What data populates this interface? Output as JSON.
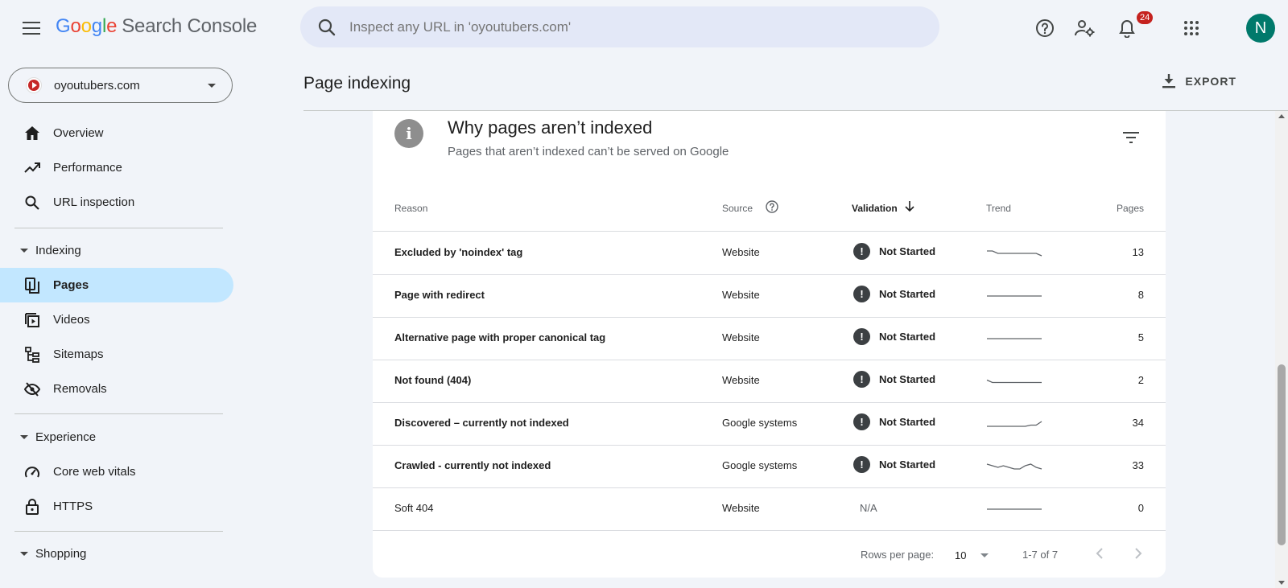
{
  "app": {
    "logo_letters": [
      "G",
      "o",
      "o",
      "g",
      "l",
      "e"
    ],
    "product": "Search Console"
  },
  "search": {
    "placeholder": "Inspect any URL in 'oyoutubers.com'"
  },
  "topbar": {
    "notification_count": "24",
    "avatar_initial": "N"
  },
  "property": {
    "name": "oyoutubers.com"
  },
  "nav": {
    "overview": "Overview",
    "performance": "Performance",
    "url_inspection": "URL inspection",
    "indexing_section": "Indexing",
    "pages": "Pages",
    "videos": "Videos",
    "sitemaps": "Sitemaps",
    "removals": "Removals",
    "experience_section": "Experience",
    "core_web_vitals": "Core web vitals",
    "https": "HTTPS",
    "shopping_section": "Shopping"
  },
  "header": {
    "title": "Page indexing",
    "export_label": "EXPORT"
  },
  "card": {
    "title": "Why pages aren’t indexed",
    "subtitle": "Pages that aren’t indexed can’t be served on Google",
    "columns": {
      "reason": "Reason",
      "source": "Source",
      "validation": "Validation",
      "trend": "Trend",
      "pages": "Pages"
    },
    "rows": [
      {
        "reason": "Excluded by 'noindex' tag",
        "source": "Website",
        "validation": "Not Started",
        "pages": "13",
        "trend": [
          13,
          13,
          12,
          12,
          12,
          12,
          12,
          12,
          12,
          12,
          11
        ]
      },
      {
        "reason": "Page with redirect",
        "source": "Website",
        "validation": "Not Started",
        "pages": "8",
        "trend": [
          8,
          8,
          8,
          8,
          8,
          8,
          8,
          8,
          8,
          8,
          8
        ]
      },
      {
        "reason": "Alternative page with proper canonical tag",
        "source": "Website",
        "validation": "Not Started",
        "pages": "5",
        "trend": [
          5,
          5,
          5,
          5,
          5,
          5,
          5,
          5,
          5,
          5,
          5
        ]
      },
      {
        "reason": "Not found (404)",
        "source": "Website",
        "validation": "Not Started",
        "pages": "2",
        "trend": [
          3,
          2,
          2,
          2,
          2,
          2,
          2,
          2,
          2,
          2,
          2
        ]
      },
      {
        "reason": "Discovered – currently not indexed",
        "source": "Google systems",
        "validation": "Not Started",
        "pages": "34",
        "trend": [
          30,
          30,
          30,
          30,
          30,
          30,
          30,
          30,
          31,
          31,
          34
        ]
      },
      {
        "reason": "Crawled - currently not indexed",
        "source": "Google systems",
        "validation": "Not Started",
        "pages": "33",
        "trend": [
          36,
          35,
          34,
          35,
          34,
          33,
          33,
          35,
          36,
          34,
          33
        ]
      },
      {
        "reason": "Soft 404",
        "source": "Website",
        "validation": "N/A",
        "pages": "0",
        "trend": [
          0,
          0,
          0,
          0,
          0,
          0,
          0,
          0,
          0,
          0,
          0
        ]
      }
    ]
  },
  "pagination": {
    "rows_per_page_label": "Rows per page:",
    "rows_per_page": "10",
    "range": "1-7 of 7"
  }
}
